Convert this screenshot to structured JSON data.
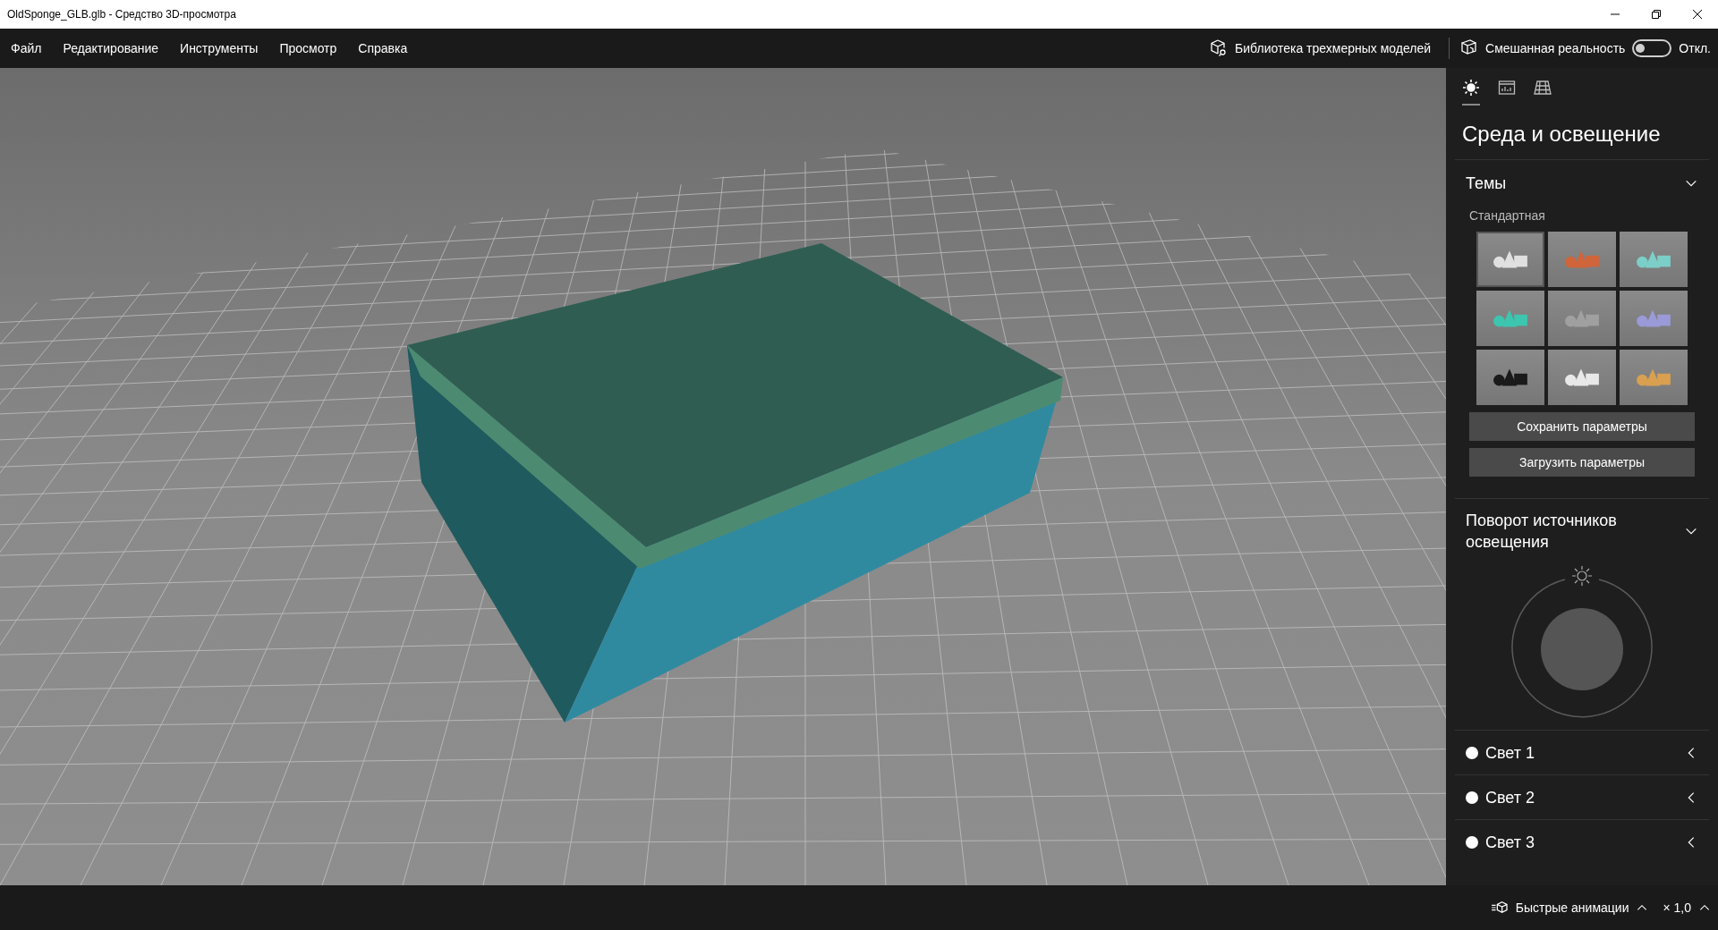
{
  "window": {
    "title": "OldSponge_GLB.glb - Средство 3D-просмотра"
  },
  "menu": [
    "Файл",
    "Редактирование",
    "Инструменты",
    "Просмотр",
    "Справка"
  ],
  "toolbar": {
    "library": "Библиотека трехмерных моделей",
    "mixed_reality": {
      "label": "Смешанная реальность",
      "on": false,
      "state": "Откл."
    }
  },
  "sidebar": {
    "tabs": [
      {
        "kind": "lighting",
        "selected": true
      },
      {
        "kind": "stats",
        "selected": false
      },
      {
        "kind": "grid",
        "selected": false
      }
    ],
    "heading": "Среда и освещение",
    "themes": {
      "title": "Темы",
      "expanded": true,
      "subtitle": "Стандартная",
      "items": [
        {
          "color": "#e0e0e0",
          "selected": true
        },
        {
          "color": "#d0643a",
          "selected": false
        },
        {
          "color": "#7ccfc8",
          "selected": false
        },
        {
          "color": "#3cc6b0",
          "selected": false
        },
        {
          "color": "#a0a0a0",
          "selected": false
        },
        {
          "color": "#9a9ad8",
          "selected": false
        },
        {
          "color": "#1a1a1a",
          "selected": false
        },
        {
          "color": "#e8e8e8",
          "selected": false
        },
        {
          "color": "#d9a050",
          "selected": false
        }
      ],
      "buttons": [
        "Сохранить параметры",
        "Загрузить параметры"
      ]
    },
    "rotation": {
      "title": "Поворот источников освещения",
      "expanded": true
    },
    "lights": [
      {
        "label": "Свет 1",
        "expanded": false
      },
      {
        "label": "Свет 2",
        "expanded": false
      },
      {
        "label": "Свет 3",
        "expanded": false
      }
    ]
  },
  "status_bar": {
    "animations": "Быстрые анимации",
    "speed": "× 1,0"
  }
}
